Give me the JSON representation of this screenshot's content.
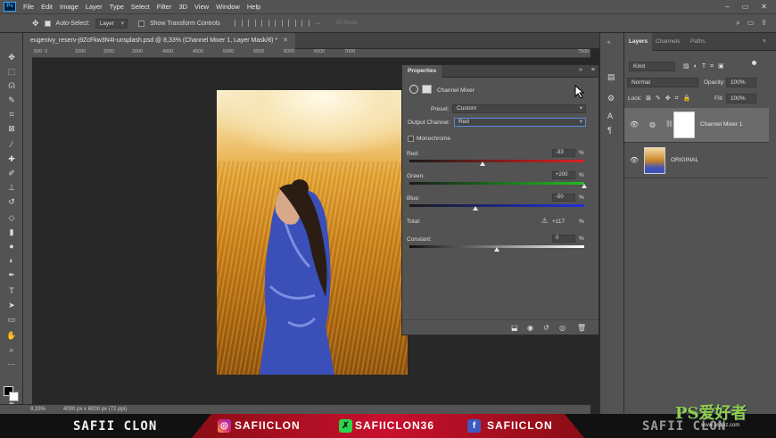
{
  "menu": [
    "File",
    "Edit",
    "Image",
    "Layer",
    "Type",
    "Select",
    "Filter",
    "3D",
    "View",
    "Window",
    "Help"
  ],
  "options": {
    "auto_select_label": "Auto-Select:",
    "auto_select_value": "Layer",
    "show_transform": "Show Transform Controls",
    "three_d": "3D Mode:"
  },
  "doc_tab": "eugenivy_reserv-j9ZcFkw3N4I-unsplash.psd @ 8,33% (Channel Mixer 1, Layer Mask/8) *",
  "ruler_ticks": [
    "500",
    "0",
    "500",
    "1000",
    "1500",
    "2000",
    "2500",
    "3000",
    "3500",
    "4000",
    "4500",
    "5000",
    "5500",
    "6000",
    "6500",
    "7000",
    "7500"
  ],
  "status": {
    "zoom": "8,33%",
    "doc_size": "4000 px x 6000 px (72 ppi)"
  },
  "properties": {
    "title": "Properties",
    "adjustment": "Channel Mixer",
    "preset_label": "Preset:",
    "preset_value": "Custom",
    "output_label": "Output Channel:",
    "output_value": "Red",
    "monochrome": "Monochrome",
    "red_label": "Red:",
    "red_value": "-33",
    "green_label": "Green:",
    "green_value": "+200",
    "blue_label": "Blue:",
    "blue_value": "-50",
    "total_label": "Total:",
    "total_value": "+117",
    "constant_label": "Constant:",
    "constant_value": "0",
    "pct": "%",
    "slider_levels": {
      "red": -33,
      "green": 200,
      "blue": -50,
      "constant": 0
    }
  },
  "layers": {
    "tabs": [
      "Layers",
      "Channels",
      "Paths"
    ],
    "kind": "Kind",
    "blend": "Normal",
    "opacity_label": "Opacity:",
    "opacity_value": "100%",
    "lock_label": "Lock:",
    "fill_label": "Fill:",
    "fill_value": "100%",
    "items": [
      {
        "name": "Channel Mixer 1",
        "selected": true
      },
      {
        "name": "ORIGINAL",
        "selected": false
      }
    ]
  },
  "banner": {
    "name": "SAFII CLON",
    "instagram": "SAFIICLON",
    "twitter": "SAFIICLON36",
    "facebook": "SAFIICLON",
    "name_right": "SAFII CLON"
  },
  "watermark": {
    "text": "PS爱好者",
    "url": "www.psahz.com"
  },
  "colors": {
    "accent": "#31a8ff",
    "panel": "#535353",
    "canvas": "#282828",
    "banner_red": "#c8102e"
  }
}
